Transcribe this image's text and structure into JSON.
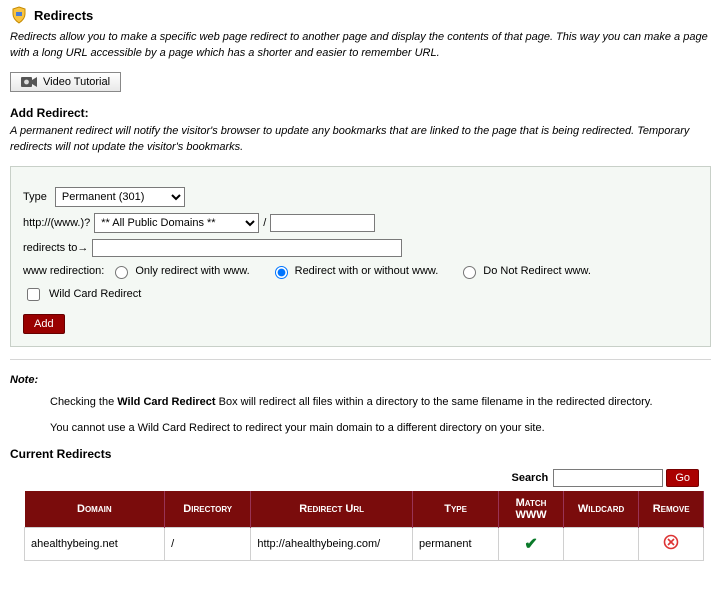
{
  "header": {
    "title": "Redirects",
    "intro": "Redirects allow you to make a specific web page redirect to another page and display the contents of that page. This way you can make a page with a long URL accessible by a page which has a shorter and easier to remember URL.",
    "video_button": "Video Tutorial"
  },
  "add": {
    "section_title": "Add Redirect:",
    "description": "A permanent redirect will notify the visitor's browser to update any bookmarks that are linked to the page that is being redirected. Temporary redirects will not update the visitor's bookmarks.",
    "type_label": "Type",
    "type_selected": "Permanent (301)",
    "url_prefix": "http://(www.)?",
    "domain_selected": "** All Public Domains **",
    "slash": "/",
    "path_value": "",
    "redirects_to_label": "redirects to→",
    "target_value": "",
    "www_label": "www redirection:",
    "www_options": {
      "only": "Only redirect with www.",
      "both": "Redirect with or without www.",
      "none": "Do Not Redirect www."
    },
    "wildcard_label": "Wild Card Redirect",
    "add_button": "Add"
  },
  "note": {
    "title": "Note:",
    "line1_a": "Checking the ",
    "line1_b": "Wild Card Redirect",
    "line1_c": " Box will redirect all files within a directory to the same filename in the redirected directory.",
    "line2": "You cannot use a Wild Card Redirect to redirect your main domain to a different directory on your site."
  },
  "current": {
    "title": "Current Redirects",
    "search_label": "Search",
    "search_value": "",
    "go_button": "Go",
    "columns": {
      "domain": "Domain",
      "directory": "Directory",
      "redirect_url": "Redirect Url",
      "type": "Type",
      "match_www": "Match WWW",
      "wildcard": "Wildcard",
      "remove": "Remove"
    },
    "rows": [
      {
        "domain": "ahealthybeing.net",
        "directory": "/",
        "redirect_url": "http://ahealthybeing.com/",
        "type": "permanent",
        "match_www": true,
        "wildcard": "",
        "remove": true
      }
    ]
  }
}
